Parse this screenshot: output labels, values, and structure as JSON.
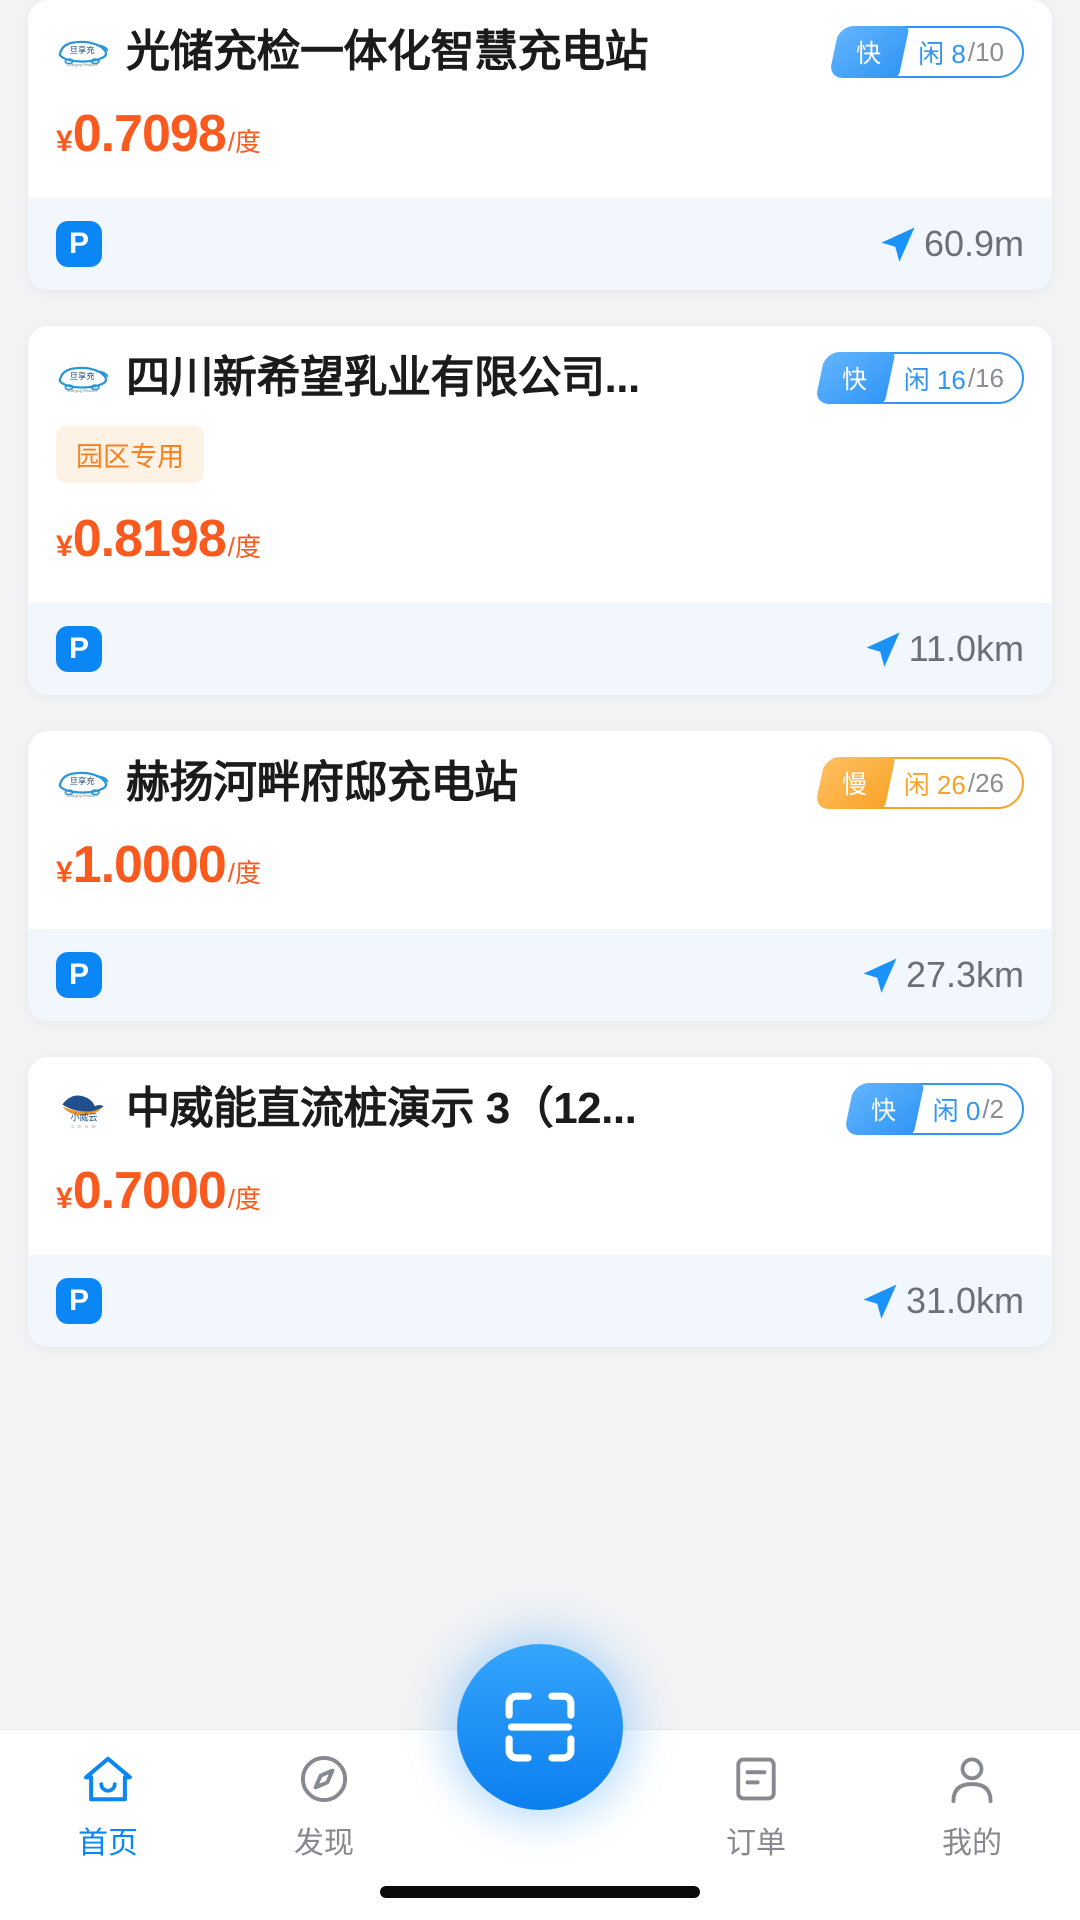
{
  "app": {
    "accent_blue": "#0a86f5",
    "accent_orange": "#fa5a1e",
    "slow_orange": "#f8a328",
    "page_background": "#f2f3f5",
    "card_footer_background": "#f2f6fd"
  },
  "stations": [
    {
      "logo": "danxiangchong-logo",
      "name": "光储充检一体化智慧充电站",
      "speed_label": "快",
      "speed_type": "fast",
      "avail_label": "闲 8",
      "avail_total": "/10",
      "tags": [],
      "price_currency": "¥",
      "price_value": "0.7098",
      "price_unit": "/度",
      "parking_icon_label": "P",
      "distance": "60.9m"
    },
    {
      "logo": "danxiangchong-logo",
      "name": "四川新希望乳业有限公司...",
      "speed_label": "快",
      "speed_type": "fast",
      "avail_label": "闲 16",
      "avail_total": "/16",
      "tags": [
        "园区专用"
      ],
      "price_currency": "¥",
      "price_value": "0.8198",
      "price_unit": "/度",
      "parking_icon_label": "P",
      "distance": "11.0km"
    },
    {
      "logo": "danxiangchong-logo",
      "name": "赫扬河畔府邸充电站",
      "speed_label": "慢",
      "speed_type": "slow",
      "avail_label": "闲 26",
      "avail_total": "/26",
      "tags": [],
      "price_currency": "¥",
      "price_value": "1.0000",
      "price_unit": "/度",
      "parking_icon_label": "P",
      "distance": "27.3km"
    },
    {
      "logo": "zhongweineng-logo",
      "name": "中威能直流桩演示 3（12...",
      "speed_label": "快",
      "speed_type": "fast",
      "avail_label": "闲 0",
      "avail_total": "/2",
      "tags": [],
      "price_currency": "¥",
      "price_value": "0.7000",
      "price_unit": "/度",
      "parking_icon_label": "P",
      "distance": "31.0km"
    }
  ],
  "tabbar": {
    "items": [
      {
        "label": "首页",
        "icon": "home-icon",
        "active": true
      },
      {
        "label": "发现",
        "icon": "compass-icon",
        "active": false
      },
      {
        "label": "订单",
        "icon": "order-icon",
        "active": false
      },
      {
        "label": "我的",
        "icon": "person-icon",
        "active": false
      }
    ],
    "fab": {
      "icon": "scan-icon"
    }
  }
}
